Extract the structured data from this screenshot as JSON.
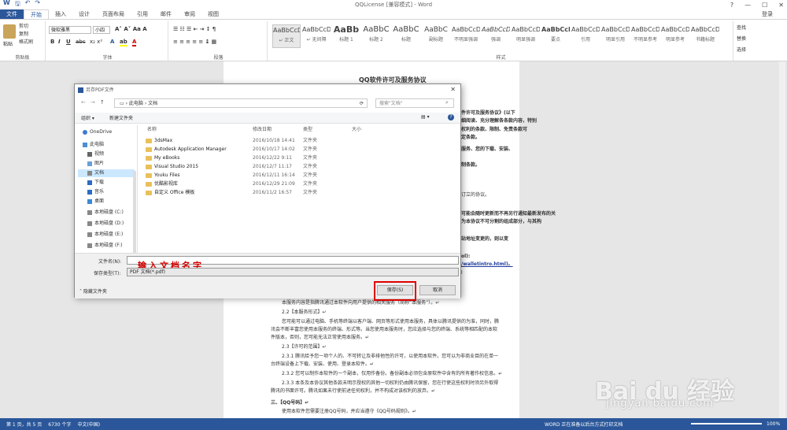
{
  "window": {
    "title": "QQLicense [兼容模式] - Word",
    "login": "登录",
    "quick_access": [
      "W",
      "🖫",
      "↶",
      "↷"
    ]
  },
  "tabs": [
    "文件",
    "开始",
    "插入",
    "设计",
    "页面布局",
    "引用",
    "邮件",
    "审阅",
    "视图"
  ],
  "ribbon": {
    "clipboard": {
      "paste": "粘贴",
      "cut": "剪切",
      "copy": "复制",
      "format_painter": "格式刷",
      "label": "剪贴板"
    },
    "font": {
      "name": "微软雅黑",
      "size": "小四",
      "label": "字体"
    },
    "paragraph": {
      "label": "段落"
    },
    "styles": {
      "label": "样式",
      "items": [
        {
          "preview": "AaBbCcDd",
          "name": "↵ 正文"
        },
        {
          "preview": "AaBbCcDd",
          "name": "↵ 无间隔"
        },
        {
          "preview": "AaBb",
          "name": "标题 1"
        },
        {
          "preview": "AaBbC",
          "name": "标题 2"
        },
        {
          "preview": "AaBbC",
          "name": "标题"
        },
        {
          "preview": "AaBbC",
          "name": "副标题"
        },
        {
          "preview": "AaBbCcDd",
          "name": "不明显强调"
        },
        {
          "preview": "AaBbCcDd",
          "name": "强调"
        },
        {
          "preview": "AaBbCcDd",
          "name": "明显强调"
        },
        {
          "preview": "AaBbCcDd",
          "name": "要点"
        },
        {
          "preview": "AaBbCcDd",
          "name": "引用"
        },
        {
          "preview": "AaBbCcDd",
          "name": "明显引用"
        },
        {
          "preview": "AaBbCcDd",
          "name": "不明显参考"
        },
        {
          "preview": "AaBbCcDd",
          "name": "明显参考"
        },
        {
          "preview": "AaBbCcDd",
          "name": "书籍标题"
        }
      ]
    },
    "editing": {
      "find": "查找",
      "replace": "替换",
      "select": "选择"
    }
  },
  "document": {
    "title": "QQ软件许可及服务协议",
    "right_fragments": [
      "件许可及服务协议》(以下",
      "细阅读、充分理解各条款内容，特别",
      "权利的条款、限制、免责条款可",
      "定条款。",
      "服务、您的下载、安装、",
      "制条款。",
      "订立的协议。",
      "可能会随时更新而不再另行通知最新发布的关",
      "为本协议不可分割的组成部分，与其构",
      "站地址变更的，则以变",
      "ol):",
      "/walletintro.html)。",
      "l"
    ],
    "lines": [
      "本服务内容是指腾讯通过本软件向用户提供的相关服务（简称“本服务”）。↵",
      "2.2【本服务形式】↵",
      "您可能可以通过电脑、手机等终端以客户端、网页等形式使用本服务，具体以腾讯提供的为准，同时，腾",
      "讯会不断丰富您使用本服务的终端、形式等。当您使用本服务时，您应选择与您的终端、系统等相匹配的本软",
      "件版本，否则，您可能无法正常使用本服务。↵",
      "2.3【许可的范围】↵",
      "2.3.1 腾讯给予您一项个人的、不可转让及非排他性的许可，以使用本软件。您可以为非商业目的在单一",
      "台终端设备上下载、安装、使用、登录本软件。↵",
      "2.3.2 您可以制作本软件的一个副本，仅用作备份。备份副本必须包含原软件中含有的所有著作权信息。↵",
      "2.3.3 本条及本协议其他条款未明示授权的其他一切权利仍由腾讯保留，您在行使这些权利时须另外取得",
      "腾讯的书面许可。腾讯如果未行使前述任何权利，并不构成对该权利的放弃。↵",
      "三、【QQ号码】↵",
      "使用本软件您需要注册QQ号码，并应当遵守《QQ号码规则》。↵"
    ]
  },
  "dialog": {
    "title": "另存PDF文件",
    "path": [
      "此电脑",
      "文档"
    ],
    "search_placeholder": "搜索\"文档\"",
    "organize": "组织 ▾",
    "new_folder": "新建文件夹",
    "nav": [
      "OneDrive",
      "此电脑",
      "视频",
      "图片",
      "文档",
      "下载",
      "音乐",
      "桌面",
      "本地磁盘 (C:)",
      "本地磁盘 (D:)",
      "本地磁盘 (E:)",
      "本地磁盘 (F:)"
    ],
    "columns": [
      "名称",
      "修改日期",
      "类型",
      "大小"
    ],
    "files": [
      {
        "name": "3dsMax",
        "date": "2016/10/18 14:41",
        "type": "文件夹"
      },
      {
        "name": "Autodesk Application Manager",
        "date": "2016/10/17 14:02",
        "type": "文件夹"
      },
      {
        "name": "My eBooks",
        "date": "2016/12/22 9:11",
        "type": "文件夹"
      },
      {
        "name": "Visual Studio 2015",
        "date": "2016/12/7 11:17",
        "type": "文件夹"
      },
      {
        "name": "Youku Files",
        "date": "2016/12/11 16:14",
        "type": "文件夹"
      },
      {
        "name": "优酷影视库",
        "date": "2016/12/29 21:09",
        "type": "文件夹"
      },
      {
        "name": "自定义 Office 模板",
        "date": "2016/11/2 16:57",
        "type": "文件夹"
      }
    ],
    "filename_label": "文件名(N):",
    "filename_value": "",
    "annotation": "输入文档名字",
    "filetype_label": "保存类型(T):",
    "filetype_value": "PDF 文档(*.pdf)",
    "hide_folders": "隐藏文件夹",
    "save": "保存(S)",
    "cancel": "取消"
  },
  "status": {
    "page": "第 1 页，共 5 页",
    "words": "6730 个字",
    "lang": "中文(中国)",
    "msg": "WORD 正在准备以后台方式打印文档",
    "zoom": "100%"
  },
  "watermark": {
    "brand": "Bai du 经验",
    "url": "jingyan.baidu.com"
  }
}
